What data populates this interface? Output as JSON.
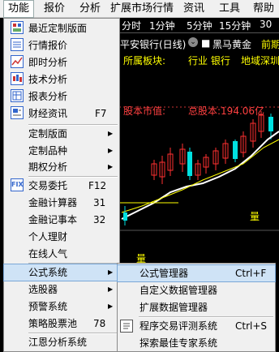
{
  "menubar": [
    "功能",
    "报价",
    "分析",
    "扩展市场行情",
    "资讯",
    "工具",
    "帮助"
  ],
  "chart": {
    "title": "平安银行(日线)",
    "indicator": "黑马黄金",
    "right_label": "前期",
    "sector_label": "所属板块:",
    "industry_label": "行业 银行",
    "region_label": "地域深圳",
    "market_cap_label": "股本市值:",
    "total_shares_label": "总股本:194.06亿",
    "periods": [
      "分时",
      "1分钟",
      "5分钟",
      "15分钟",
      "30"
    ],
    "marker": "量",
    "marker2": "量"
  },
  "func_menu": [
    {
      "label": "最近定制版面",
      "icon": "layout-icon"
    },
    {
      "label": "行情报价",
      "icon": "quote-table-icon"
    },
    {
      "label": "即时分析",
      "icon": "line-chart-icon"
    },
    {
      "label": "技术分析",
      "icon": "candlestick-icon"
    },
    {
      "label": "报表分析",
      "icon": "report-icon"
    },
    {
      "label": "财经资讯",
      "shortcut": "F7",
      "icon": "news-icon"
    },
    {
      "label": "定制版面",
      "submenu": true
    },
    {
      "label": "定制品种",
      "submenu": true
    },
    {
      "label": "期权分析",
      "submenu": true
    },
    {
      "label": "交易委托",
      "shortcut": "F12",
      "icon": "fix-trade-icon"
    },
    {
      "label": "金融计算器",
      "shortcut": "31"
    },
    {
      "label": "金融记事本",
      "shortcut": "32"
    },
    {
      "label": "个人理财"
    },
    {
      "label": "在线人气"
    },
    {
      "label": "公式系统",
      "submenu": true
    },
    {
      "label": "选股器",
      "submenu": true
    },
    {
      "label": "预警系统",
      "submenu": true
    },
    {
      "label": "策略股票池",
      "shortcut": "78"
    },
    {
      "label": "江恩分析系统"
    }
  ],
  "formula_menu": [
    {
      "label": "公式管理器",
      "shortcut": "Ctrl+F",
      "icon": "formula-icon"
    },
    {
      "label": "自定义数据管理器"
    },
    {
      "label": "扩展数据管理器"
    },
    {
      "label": "程序交易评测系统",
      "shortcut": "Ctrl+S",
      "icon": "doc-icon"
    },
    {
      "label": "探索最佳专家系统"
    }
  ]
}
